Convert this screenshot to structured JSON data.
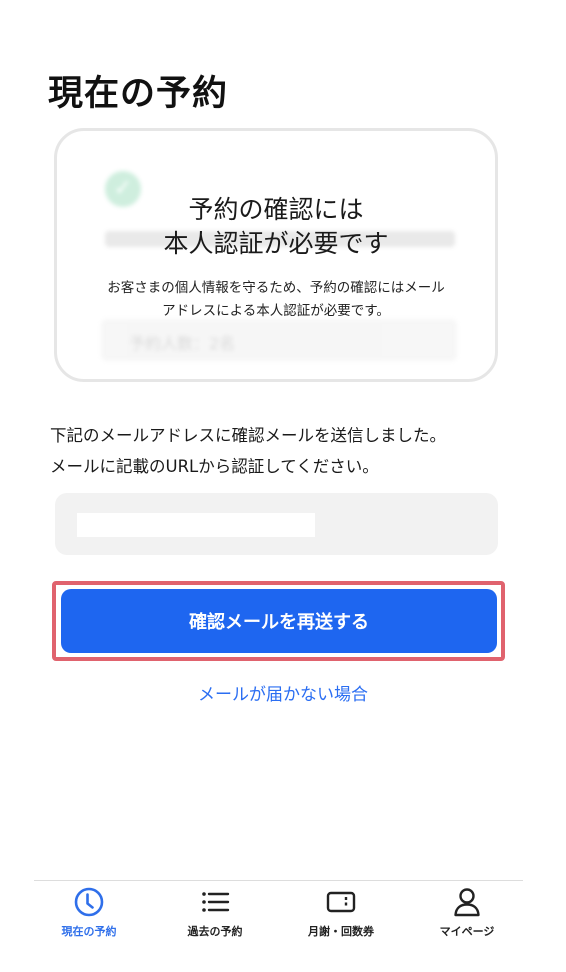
{
  "page": {
    "title": "現在の予約"
  },
  "card": {
    "title_lines": [
      "予約の確認には",
      "本人認証が必要です"
    ],
    "description_lines": [
      "お客さまの個人情報を守るため、予約の確認にはメール",
      "アドレスによる本人認証が必要です。"
    ],
    "background_preview": {
      "reservation_count": "予約人数：2名"
    }
  },
  "instructions": {
    "lines": [
      "下記のメールアドレスに確認メールを送信しました。",
      "メールに記載のURLから認証してください。"
    ]
  },
  "email_field": {
    "value": ""
  },
  "resend_button": {
    "label": "確認メールを再送する"
  },
  "help_link": {
    "label": "メールが届かない場合"
  },
  "tabbar": {
    "items": [
      {
        "label": "現在の予約",
        "icon": "clock-icon",
        "active": true
      },
      {
        "label": "過去の予約",
        "icon": "list-icon",
        "active": false
      },
      {
        "label": "月謝・回数券",
        "icon": "ticket-icon",
        "active": false
      },
      {
        "label": "マイページ",
        "icon": "person-icon",
        "active": false
      }
    ]
  },
  "colors": {
    "accent": "#1e66f0",
    "link": "#2b6ef2",
    "highlight": "#e0636e",
    "active_tab": "#2f6fea"
  }
}
